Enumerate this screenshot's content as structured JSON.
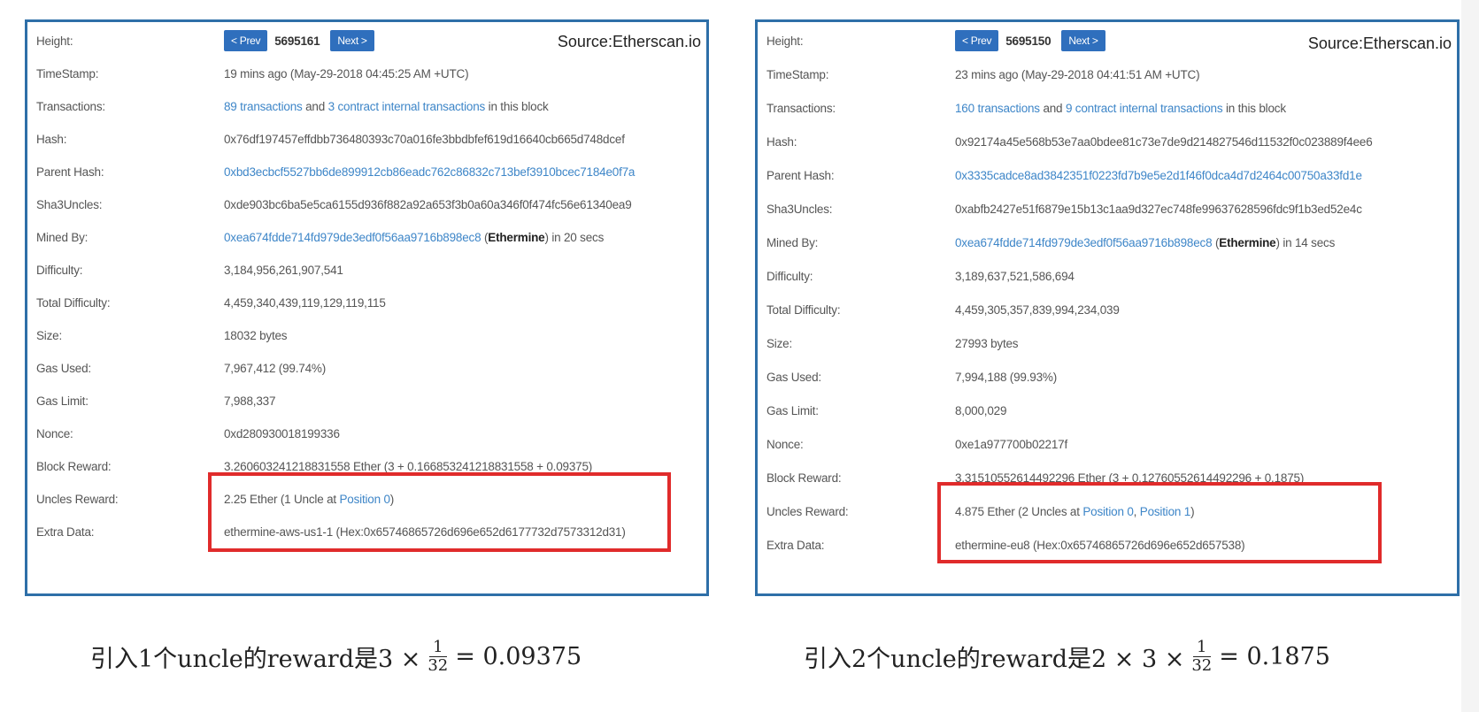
{
  "left": {
    "source": "Source:Etherscan.io",
    "height_label": "Height:",
    "prev": "< Prev",
    "block_number": "5695161",
    "next": "Next >",
    "timestamp_label": "TimeStamp:",
    "timestamp": "19 mins ago (May-29-2018 04:45:25 AM +UTC)",
    "transactions_label": "Transactions:",
    "tx_link": "89 transactions",
    "tx_and": "and",
    "internal_link": "3 contract internal transactions",
    "tx_tail": "in this block",
    "hash_label": "Hash:",
    "hash": "0x76df197457effdbb736480393c70a016fe3bbdbfef619d16640cb665d748dcef",
    "parent_label": "Parent Hash:",
    "parent": "0xbd3ecbcf5527bb6de899912cb86eadc762c86832c713bef3910bcec7184e0f7a",
    "sha3_label": "Sha3Uncles:",
    "sha3": "0xde903bc6ba5e5ca6155d936f882a92a653f3b0a60a346f0f474fc56e61340ea9",
    "mined_label": "Mined By:",
    "miner_link": "0xea674fdde714fd979de3edf0f56aa9716b898ec8",
    "miner_name": "Ethermine",
    "mined_tail": "in 20 secs",
    "difficulty_label": "Difficulty:",
    "difficulty": "3,184,956,261,907,541",
    "total_label": "Total Difficulty:",
    "total": "4,459,340,439,119,129,119,115",
    "size_label": "Size:",
    "size": "18032 bytes",
    "gas_used_label": "Gas Used:",
    "gas_used": "7,967,412 (99.74%)",
    "gas_limit_label": "Gas Limit:",
    "gas_limit": "7,988,337",
    "nonce_label": "Nonce:",
    "nonce": "0xd280930018199336",
    "block_reward_label": "Block Reward:",
    "block_reward": "3.260603241218831558 Ether (3 + 0.166853241218831558 + 0.09375)",
    "uncles_label": "Uncles Reward:",
    "uncles_text": "2.25 Ether (1 Uncle at",
    "uncles_pos1": "Position 0",
    "uncles_close": ")",
    "extra_label": "Extra Data:",
    "extra": "ethermine-aws-us1-1 (Hex:0x65746865726d696e652d6177732d7573312d31)"
  },
  "right": {
    "source": "Source:Etherscan.io",
    "height_label": "Height:",
    "prev": "< Prev",
    "block_number": "5695150",
    "next": "Next >",
    "timestamp_label": "TimeStamp:",
    "timestamp": "23 mins ago (May-29-2018 04:41:51 AM +UTC)",
    "transactions_label": "Transactions:",
    "tx_link": "160 transactions",
    "tx_and": "and",
    "internal_link": "9 contract internal transactions",
    "tx_tail": "in this block",
    "hash_label": "Hash:",
    "hash": "0x92174a45e568b53e7aa0bdee81c73e7de9d214827546d11532f0c023889f4ee6",
    "parent_label": "Parent Hash:",
    "parent": "0x3335cadce8ad3842351f0223fd7b9e5e2d1f46f0dca4d7d2464c00750a33fd1e",
    "sha3_label": "Sha3Uncles:",
    "sha3": "0xabfb2427e51f6879e15b13c1aa9d327ec748fe99637628596fdc9f1b3ed52e4c",
    "mined_label": "Mined By:",
    "miner_link": "0xea674fdde714fd979de3edf0f56aa9716b898ec8",
    "miner_name": "Ethermine",
    "mined_tail": "in 14 secs",
    "difficulty_label": "Difficulty:",
    "difficulty": "3,189,637,521,586,694",
    "total_label": "Total Difficulty:",
    "total": "4,459,305,357,839,994,234,039",
    "size_label": "Size:",
    "size": "27993 bytes",
    "gas_used_label": "Gas Used:",
    "gas_used": "7,994,188 (99.93%)",
    "gas_limit_label": "Gas Limit:",
    "gas_limit": "8,000,029",
    "nonce_label": "Nonce:",
    "nonce": "0xe1a977700b02217f",
    "block_reward_label": "Block Reward:",
    "block_reward": "3.31510552614492296 Ether (3 + 0.12760552614492296 + 0.1875)",
    "uncles_label": "Uncles Reward:",
    "uncles_text": "4.875 Ether (2 Uncles at",
    "uncles_pos1": "Position 0",
    "uncles_comma": ",",
    "uncles_pos2": "Position 1",
    "uncles_close": ")",
    "extra_label": "Extra Data:",
    "extra": "ethermine-eu8 (Hex:0x65746865726d696e652d657538)"
  },
  "captions": {
    "left_prefix": "引入1个uncle的reward是3 ×",
    "left_num": "1",
    "left_den": "32",
    "left_result": "= 0.09375",
    "right_prefix": "引入2个uncle的reward是2 × 3 ×",
    "right_num": "1",
    "right_den": "32",
    "right_result": "= 0.1875"
  },
  "colors": {
    "panel_border": "#2e6fa8",
    "link": "#3e86c8",
    "button": "#2f6fbd",
    "highlight": "#e02b2b"
  }
}
